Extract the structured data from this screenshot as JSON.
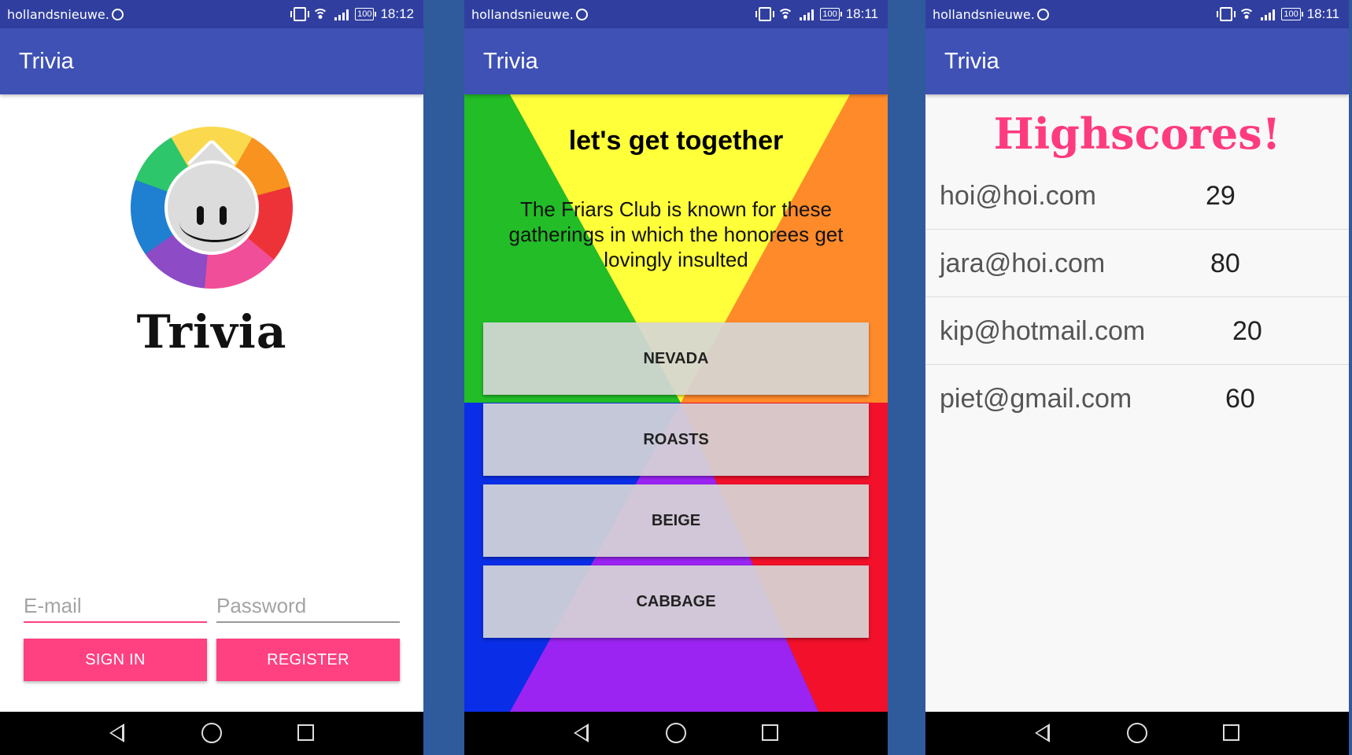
{
  "statusbar": {
    "carrier": "hollandsnieuwe.",
    "battery": "100",
    "times": [
      "18:12",
      "18:11",
      "18:11"
    ]
  },
  "app": {
    "title": "Trivia"
  },
  "login": {
    "brand": "Trivia",
    "email_placeholder": "E-mail",
    "password_placeholder": "Password",
    "sign_in_label": "SIGN IN",
    "register_label": "REGISTER"
  },
  "question": {
    "title": "let's get together",
    "text": "The Friars Club is known for these gatherings in which the honorees get lovingly insulted",
    "answers": [
      "NEVADA",
      "ROASTS",
      "BEIGE",
      "CABBAGE"
    ]
  },
  "highscores": {
    "title": "Highscores!",
    "rows": [
      {
        "email": "hoi@hoi.com",
        "score": "29"
      },
      {
        "email": "jara@hoi.com",
        "score": "80"
      },
      {
        "email": "kip@hotmail.com",
        "score": "20"
      },
      {
        "email": "piet@gmail.com",
        "score": "60"
      }
    ]
  },
  "colors": {
    "primary": "#3f51b5",
    "primary_dark": "#303f9f",
    "accent": "#ff4081",
    "background": "#2f5a9c"
  },
  "icons": [
    "whatsapp-icon",
    "vibrate-icon",
    "wifi-icon",
    "signal-icon",
    "battery-icon",
    "nav-back-icon",
    "nav-home-icon",
    "nav-recents-icon",
    "trivia-logo-icon"
  ]
}
